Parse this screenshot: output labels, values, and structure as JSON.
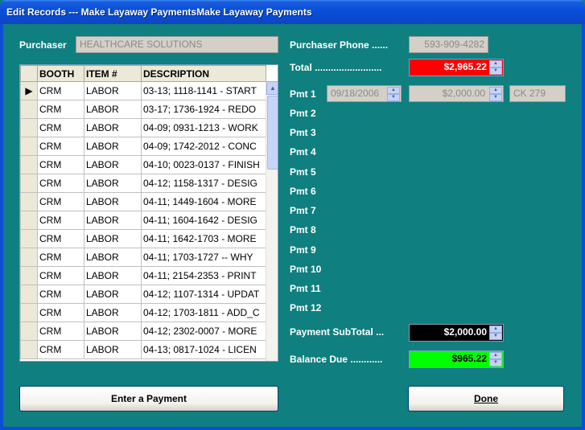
{
  "window": {
    "title": "Edit Records --- Make Layaway PaymentsMake Layaway Payments"
  },
  "purchaser": {
    "label": "Purchaser",
    "value": "HEALTHCARE  SOLUTIONS"
  },
  "purchaser_phone": {
    "label": "Purchaser Phone ......",
    "value": "593-909-4282"
  },
  "total": {
    "label": "Total .........................",
    "value": "$2,965.22",
    "color": "#FF0000"
  },
  "grid": {
    "columns": [
      "BOOTH",
      "ITEM #",
      "DESCRIPTION"
    ],
    "current_row_marker": "▶",
    "rows": [
      [
        "CRM",
        "LABOR",
        "03-13; 1118-1141 - START"
      ],
      [
        "CRM",
        "LABOR",
        "03-17; 1736-1924 - REDO"
      ],
      [
        "CRM",
        "LABOR",
        "04-09; 0931-1213 - WORK"
      ],
      [
        "CRM",
        "LABOR",
        "04-09; 1742-2012 - CONC"
      ],
      [
        "CRM",
        "LABOR",
        "04-10; 0023-0137 - FINISH"
      ],
      [
        "CRM",
        "LABOR",
        "04-12; 1158-1317 - DESIG"
      ],
      [
        "CRM",
        "LABOR",
        "04-11; 1449-1604 - MORE"
      ],
      [
        "CRM",
        "LABOR",
        "04-11; 1604-1642 - DESIG"
      ],
      [
        "CRM",
        "LABOR",
        "04-11; 1642-1703 - MORE"
      ],
      [
        "CRM",
        "LABOR",
        "04-11; 1703-1727 -- WHY"
      ],
      [
        "CRM",
        "LABOR",
        "04-11; 2154-2353 - PRINT"
      ],
      [
        "CRM",
        "LABOR",
        "04-12; 1107-1314 - UPDAT"
      ],
      [
        "CRM",
        "LABOR",
        "04-12; 1703-1811 - ADD_C"
      ],
      [
        "CRM",
        "LABOR",
        "04-12; 2302-0007 - MORE"
      ],
      [
        "CRM",
        "LABOR",
        "04-13; 0817-1024 - LICEN"
      ]
    ]
  },
  "payments": [
    {
      "label": "Pmt   1",
      "date": "09/18/2006",
      "amount": "$2,000.00",
      "ref": "CK  279"
    },
    {
      "label": "Pmt   2"
    },
    {
      "label": "Pmt   3"
    },
    {
      "label": "Pmt   4"
    },
    {
      "label": "Pmt   5"
    },
    {
      "label": "Pmt   6"
    },
    {
      "label": "Pmt   7"
    },
    {
      "label": "Pmt   8"
    },
    {
      "label": "Pmt   9"
    },
    {
      "label": "Pmt 10"
    },
    {
      "label": "Pmt 11"
    },
    {
      "label": "Pmt 12"
    }
  ],
  "subtotal": {
    "label": "Payment SubTotal ...",
    "value": "$2,000.00",
    "color": "#000000"
  },
  "balance": {
    "label": "Balance Due ............",
    "value": "$965.22",
    "color": "#00FF00"
  },
  "buttons": {
    "enter_payment": "Enter a Payment",
    "done": "Done"
  },
  "colors": {
    "background": "#0F7F7F",
    "titlebar": "#0A50D8"
  }
}
